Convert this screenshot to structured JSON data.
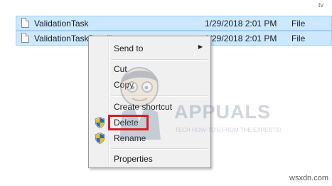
{
  "explorer": {
    "rows": [
      {
        "name": "ValidationTask",
        "date": "1/29/2018 2:01 PM",
        "type": "File"
      },
      {
        "name": "ValidationTaskDeadli",
        "date": "1/29/2018 2:01 PM",
        "type": "File"
      }
    ],
    "top_right_fragment": "ty"
  },
  "context_menu": {
    "send_to": "Send to",
    "cut": "Cut",
    "copy": "Copy",
    "create_shortcut": "Create shortcut",
    "delete": "Delete",
    "rename": "Rename",
    "properties": "Properties",
    "submenu_arrow": "▶"
  },
  "watermark": {
    "word": "APPUALS",
    "tagline": "TECH HOW-TO'S FROM THE EXPERTS!"
  },
  "credit": "wsxdn.com",
  "colors": {
    "selection": "#cce8ff",
    "highlight": "#d21f2b",
    "menu_bg": "#f0f0f0"
  },
  "icons": [
    "file-icon",
    "shield-icon",
    "submenu-arrow-icon",
    "mascot-icon"
  ]
}
